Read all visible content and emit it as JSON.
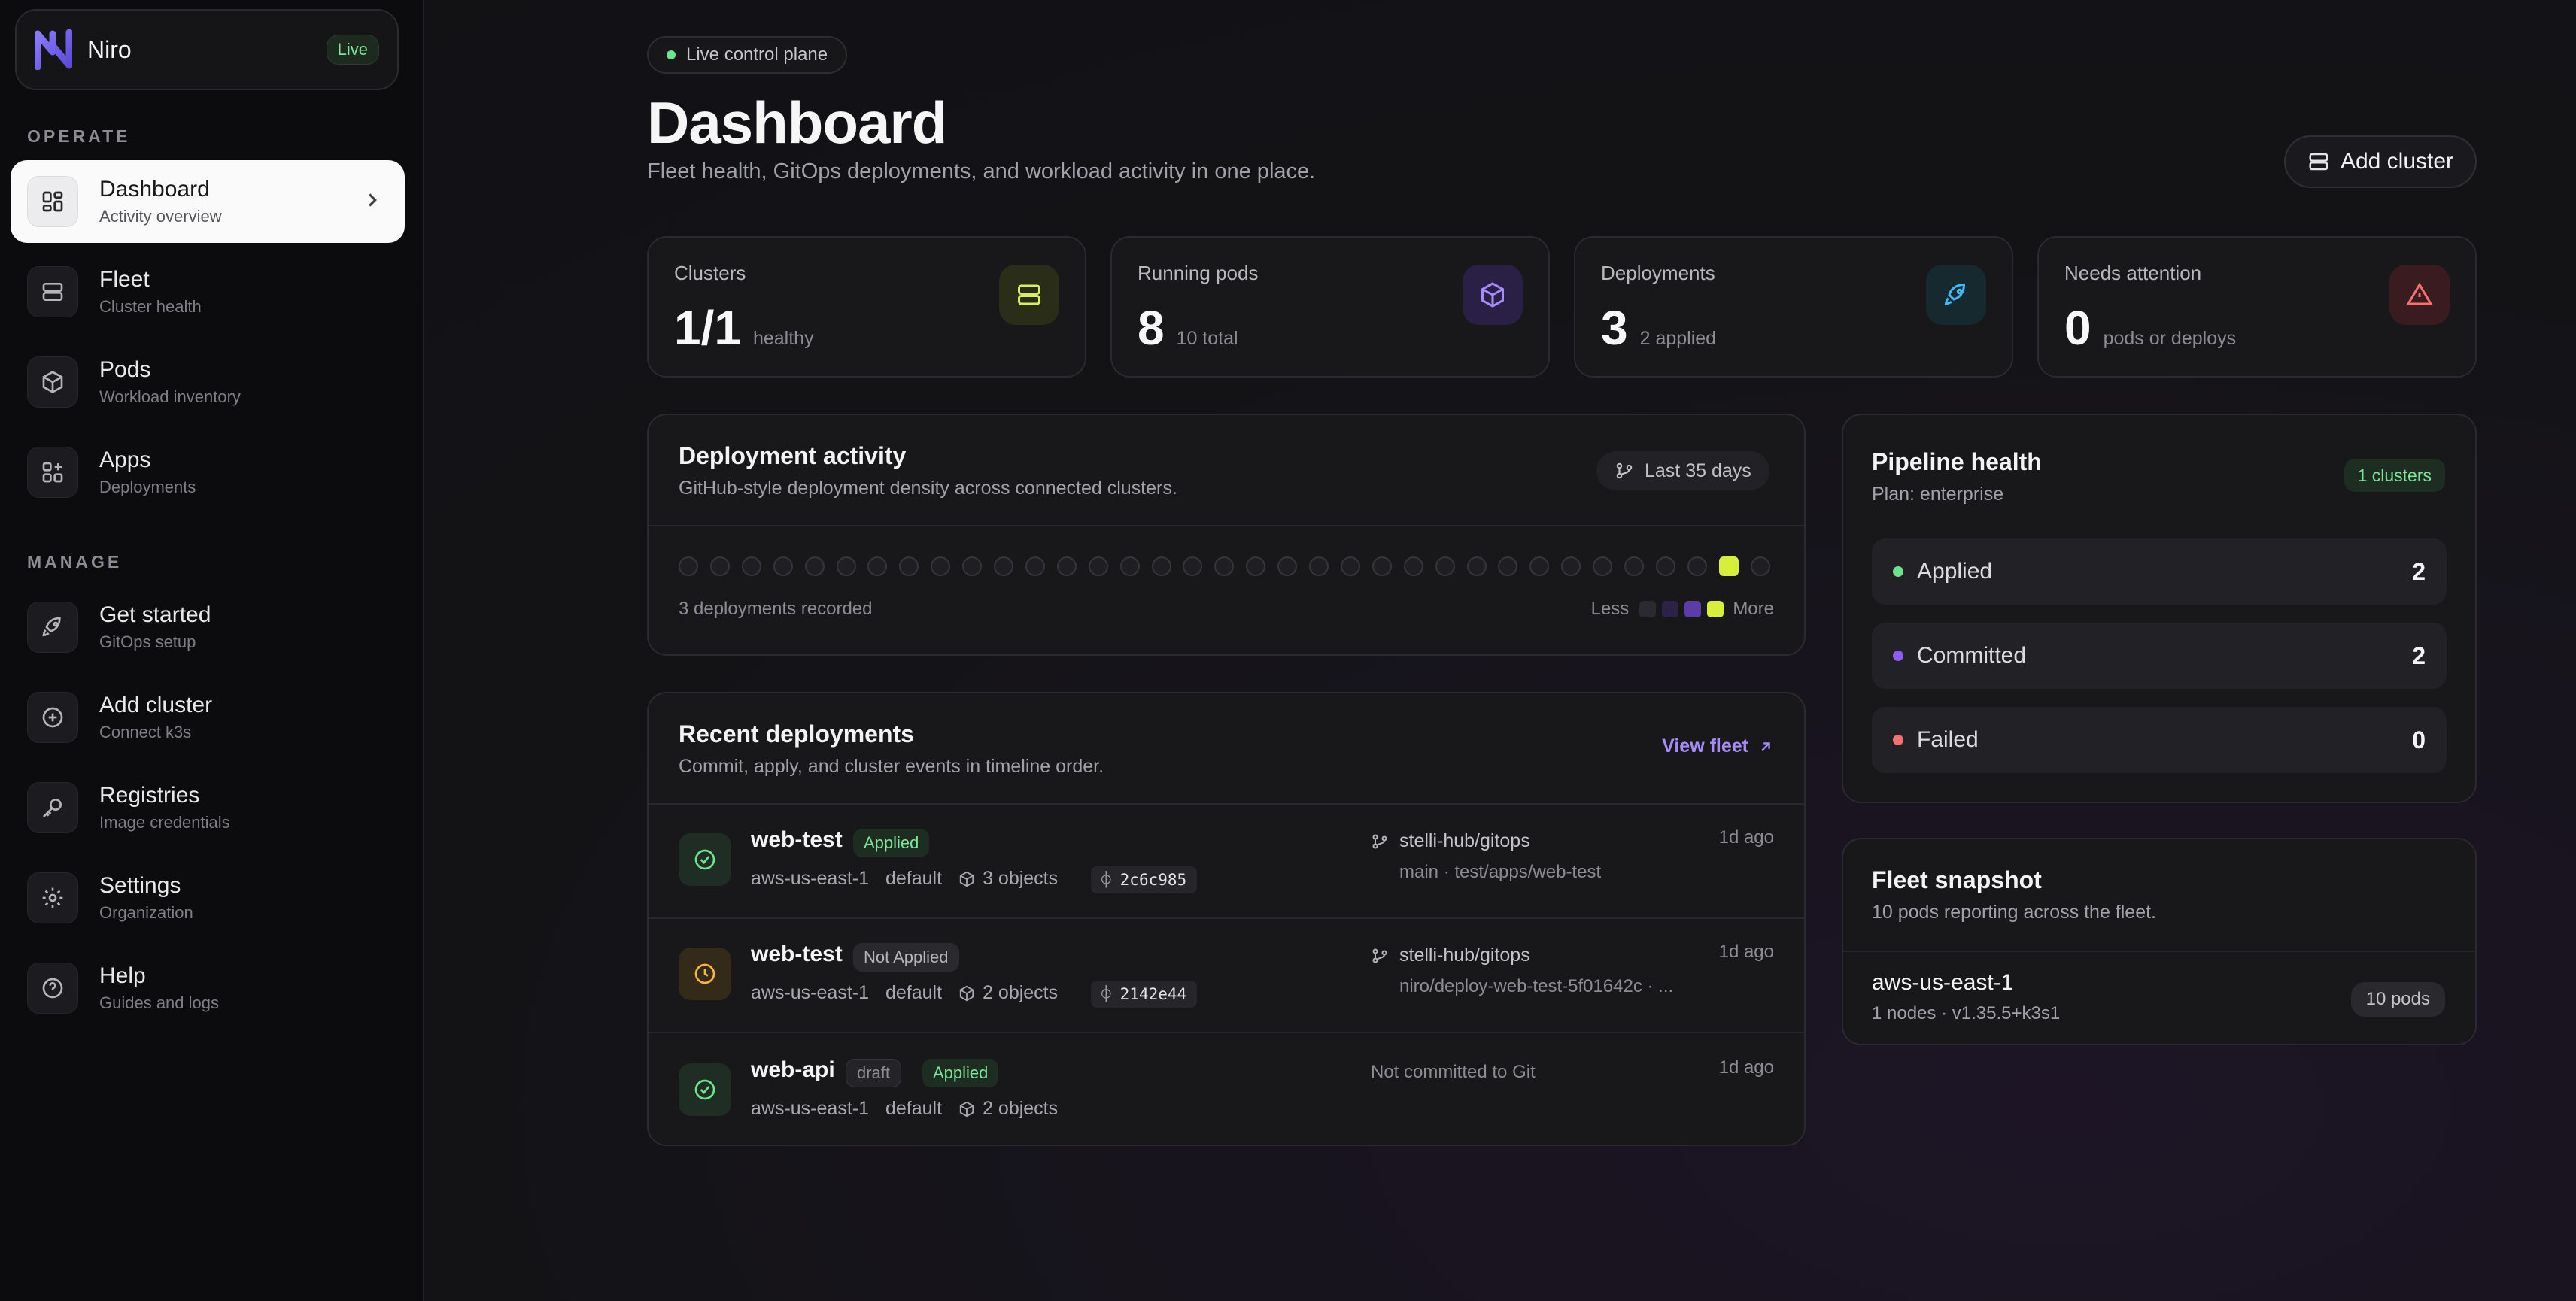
{
  "app": {
    "name": "Niro",
    "live_label": "Live"
  },
  "sidebar": {
    "operate_label": "OPERATE",
    "manage_label": "MANAGE",
    "items": [
      {
        "title": "Dashboard",
        "sub": "Activity overview",
        "icon": "dashboard-icon"
      },
      {
        "title": "Fleet",
        "sub": "Cluster health",
        "icon": "server-icon"
      },
      {
        "title": "Pods",
        "sub": "Workload inventory",
        "icon": "cube-icon"
      },
      {
        "title": "Apps",
        "sub": "Deployments",
        "icon": "apps-icon"
      },
      {
        "title": "Get started",
        "sub": "GitOps setup",
        "icon": "rocket-icon"
      },
      {
        "title": "Add cluster",
        "sub": "Connect k3s",
        "icon": "plus-circle-icon"
      },
      {
        "title": "Registries",
        "sub": "Image credentials",
        "icon": "key-icon"
      },
      {
        "title": "Settings",
        "sub": "Organization",
        "icon": "gear-icon"
      },
      {
        "title": "Help",
        "sub": "Guides and logs",
        "icon": "help-icon"
      }
    ]
  },
  "header": {
    "pill": "Live control plane",
    "title": "Dashboard",
    "subtitle": "Fleet health, GitOps deployments, and workload activity in one place.",
    "add_cluster": "Add cluster"
  },
  "stats": [
    {
      "label": "Clusters",
      "value": "1/1",
      "note": "healthy",
      "accent": "#d7ef5a"
    },
    {
      "label": "Running pods",
      "value": "8",
      "note": "10 total",
      "accent": "#8b5cf6"
    },
    {
      "label": "Deployments",
      "value": "3",
      "note": "2 applied",
      "accent": "#38bdf8"
    },
    {
      "label": "Needs attention",
      "value": "0",
      "note": "pods or deploys",
      "accent": "#f87171"
    }
  ],
  "activity": {
    "title": "Deployment activity",
    "subtitle": "GitHub-style deployment density across connected clusters.",
    "range": "Last 35 days",
    "days": [
      0,
      0,
      0,
      0,
      0,
      0,
      0,
      0,
      0,
      0,
      0,
      0,
      0,
      0,
      0,
      0,
      0,
      0,
      0,
      0,
      0,
      0,
      0,
      0,
      0,
      0,
      0,
      0,
      0,
      0,
      0,
      0,
      0,
      3,
      0
    ],
    "recorded": "3 deployments recorded",
    "less": "Less",
    "more": "More",
    "colors": {
      "empty": "#1f1f23",
      "l1": "#2c2346",
      "l2": "#5b3ca8",
      "l3": "#d7ef3a"
    }
  },
  "recent": {
    "title": "Recent deployments",
    "subtitle": "Commit, apply, and cluster events in timeline order.",
    "view_fleet": "View fleet",
    "rows": [
      {
        "name": "web-test",
        "status": "Applied",
        "status_kind": "applied",
        "cluster": "aws-us-east-1",
        "namespace": "default",
        "objects": "3 objects",
        "commit": "2c6c985",
        "repo": "stelli-hub/gitops",
        "path": "main · test/apps/web-test",
        "ago": "1d ago",
        "icon": "check-circle-icon"
      },
      {
        "name": "web-test",
        "status": "Not Applied",
        "status_kind": "notapplied",
        "cluster": "aws-us-east-1",
        "namespace": "default",
        "objects": "2 objects",
        "commit": "2142e44",
        "repo": "stelli-hub/gitops",
        "path": "niro/deploy-web-test-5f01642c · ...",
        "ago": "1d ago",
        "icon": "clock-icon"
      },
      {
        "name": "web-api",
        "draft": "draft",
        "status": "Applied",
        "status_kind": "applied",
        "cluster": "aws-us-east-1",
        "namespace": "default",
        "objects": "2 objects",
        "repo_note": "Not committed to Git",
        "ago": "1d ago",
        "icon": "check-circle-icon"
      }
    ]
  },
  "pipeline": {
    "title": "Pipeline health",
    "plan": "Plan: enterprise",
    "badge": "1 clusters",
    "rows": [
      {
        "label": "Applied",
        "value": "2",
        "color": "#6ee38d"
      },
      {
        "label": "Committed",
        "value": "2",
        "color": "#8b5cf6"
      },
      {
        "label": "Failed",
        "value": "0",
        "color": "#f87171"
      }
    ]
  },
  "fleet": {
    "title": "Fleet snapshot",
    "subtitle": "10 pods reporting across the fleet.",
    "cluster": "aws-us-east-1",
    "cluster_meta": "1 nodes · v1.35.5+k3s1",
    "pods": "10 pods"
  }
}
